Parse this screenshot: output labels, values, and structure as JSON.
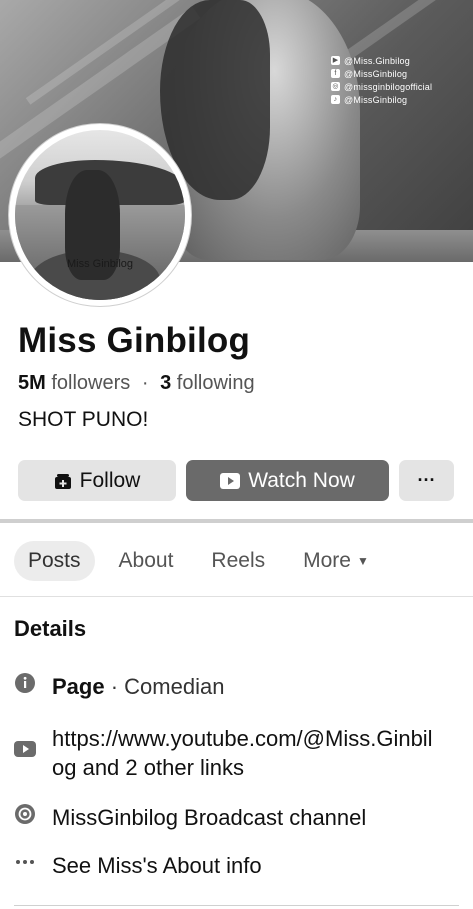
{
  "cover": {
    "social_handles": [
      {
        "icon": "youtube-icon",
        "text": "@Miss.Ginbilog"
      },
      {
        "icon": "facebook-icon",
        "text": "@MissGinbilog"
      },
      {
        "icon": "instagram-icon",
        "text": "@missginbilogofficial"
      },
      {
        "icon": "tiktok-icon",
        "text": "@MissGinbilog"
      }
    ]
  },
  "avatar": {
    "watermark": "Miss Ginbilog"
  },
  "profile": {
    "name": "Miss Ginbilog",
    "followers_count": "5M",
    "followers_label": "followers",
    "separator": "·",
    "following_count": "3",
    "following_label": "following",
    "bio": "SHOT PUNO!"
  },
  "actions": {
    "follow_label": "Follow",
    "watch_label": "Watch Now",
    "more_label": "···"
  },
  "tabs": [
    {
      "label": "Posts",
      "active": true
    },
    {
      "label": "About",
      "active": false
    },
    {
      "label": "Reels",
      "active": false
    },
    {
      "label": "More",
      "active": false
    }
  ],
  "details": {
    "heading": "Details",
    "page_label": "Page",
    "page_category": " · Comedian",
    "links_text": "https://www.youtube.com/@Miss.Ginbilog and 2 other links",
    "broadcast_text": "MissGinbilog Broadcast channel",
    "about_text": "See Miss's About info"
  },
  "colors": {
    "watch_button_bg": "#6a6a6a",
    "button_bg": "#e4e4e4",
    "active_tab_bg": "#ececec"
  }
}
